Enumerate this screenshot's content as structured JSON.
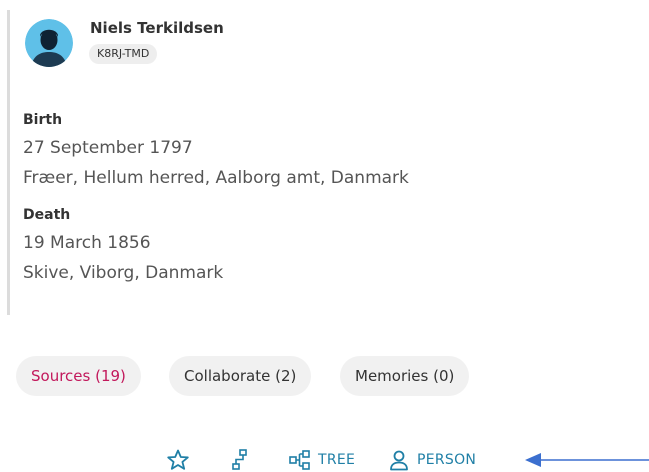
{
  "person": {
    "name": "Niels Terkildsen",
    "id": "K8RJ-TMD"
  },
  "events": [
    {
      "label": "Birth",
      "date": "27 September 1797",
      "place": "Fræer, Hellum herred, Aalborg amt, Danmark"
    },
    {
      "label": "Death",
      "date": "19 March 1856",
      "place": "Skive, Viborg, Danmark"
    }
  ],
  "pills": {
    "sources": "Sources (19)",
    "collaborate": "Collaborate (2)",
    "memories": "Memories (0)"
  },
  "actions": {
    "tree": "TREE",
    "person": "PERSON"
  },
  "colors": {
    "accent_link": "#1f7fa6",
    "sources_text": "#c2185b",
    "avatar_bg": "#5fc0e8",
    "arrow": "#3b6fcf"
  }
}
